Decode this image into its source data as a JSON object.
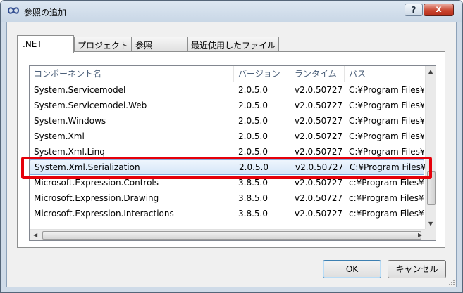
{
  "window": {
    "title": "参照の追加",
    "help_label": "?",
    "close_label": "x"
  },
  "tabs": [
    {
      "label": ".NET",
      "active": true
    },
    {
      "label": "プロジェクト",
      "active": false
    },
    {
      "label": "参照",
      "active": false
    },
    {
      "label": "最近使用したファイル",
      "active": false
    }
  ],
  "list": {
    "columns": [
      "コンポーネント名",
      "バージョン",
      "ランタイム",
      "パス"
    ],
    "rows": [
      [
        "System.Servicemodel",
        "2.0.5.0",
        "v2.0.50727",
        "C:¥Program Files¥"
      ],
      [
        "System.Servicemodel.Web",
        "2.0.5.0",
        "v2.0.50727",
        "C:¥Program Files¥"
      ],
      [
        "System.Windows",
        "2.0.5.0",
        "v2.0.50727",
        "C:¥Program Files¥"
      ],
      [
        "System.Xml",
        "2.0.5.0",
        "v2.0.50727",
        "C:¥Program Files¥"
      ],
      [
        "System.Xml.Linq",
        "2.0.5.0",
        "v2.0.50727",
        "C:¥Program Files¥"
      ],
      [
        "System.Xml.Serialization",
        "2.0.5.0",
        "v2.0.50727",
        "C:¥Program Files¥"
      ],
      [
        "Microsoft.Expression.Controls",
        "3.8.5.0",
        "v2.0.50727",
        "c:¥Program Files¥"
      ],
      [
        "Microsoft.Expression.Drawing",
        "3.8.5.0",
        "v2.0.50727",
        "c:¥Program Files¥"
      ],
      [
        "Microsoft.Expression.Interactions",
        "3.8.5.0",
        "v2.0.50727",
        "c:¥Program Files¥"
      ]
    ],
    "selected_index": 5
  },
  "buttons": {
    "ok": "OK",
    "cancel": "キャンセル"
  },
  "colors": {
    "highlight": "#e5000a",
    "selection": "#d5e6f8"
  }
}
